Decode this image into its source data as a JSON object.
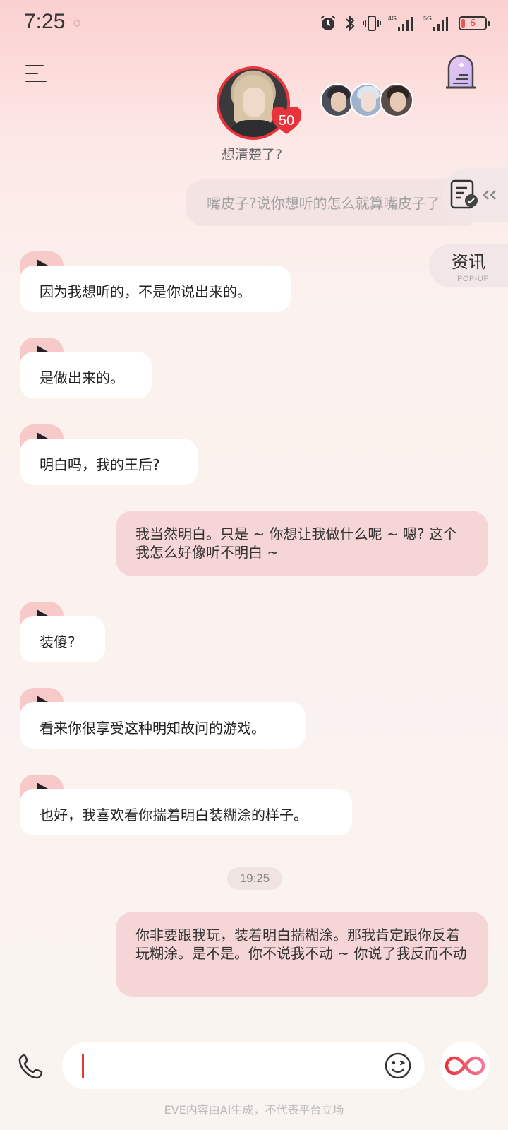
{
  "status_bar": {
    "time": "7:25",
    "network_4g": "4G",
    "network_5g": "5G",
    "battery": "6"
  },
  "header": {
    "affinity_level": "50",
    "character_status": "想清楚了?",
    "icons": [
      "menu-icon",
      "tower-window-icon"
    ]
  },
  "side": {
    "news_title": "资讯",
    "news_subtitle": "POP-UP"
  },
  "chat": {
    "faded_user_message": "嘴皮子?说你想听的怎么就算嘴皮子了",
    "messages": [
      {
        "role": "ai",
        "text": "因为我想听的，不是你说出来的。"
      },
      {
        "role": "ai",
        "text": "是做出来的。"
      },
      {
        "role": "ai",
        "text": "明白吗，我的王后?"
      },
      {
        "role": "user",
        "text": "我当然明白。只是 ~ 你想让我做什么呢 ~ 嗯? 这个我怎么好像听不明白 ~"
      },
      {
        "role": "ai",
        "text": "装傻?"
      },
      {
        "role": "ai",
        "text": "看来你很享受这种明知故问的游戏。"
      },
      {
        "role": "ai",
        "text": "也好，我喜欢看你揣着明白装糊涂的样子。"
      },
      {
        "role": "user",
        "text": "你非要跟我玩，装着明白揣糊涂。那我肯定跟你反着玩糊涂。是不是。你不说我不动 ~ 你说了我反而不动"
      }
    ],
    "timestamp": "19:25"
  },
  "input": {
    "placeholder": ""
  },
  "footer": {
    "disclaimer": "EVE内容由AI生成，不代表平台立场"
  },
  "colors": {
    "accent": "#e8333a",
    "user_bubble": "#f5d5d5",
    "ai_bubble": "#ffffff",
    "play_tag": "#f8c9c9"
  }
}
